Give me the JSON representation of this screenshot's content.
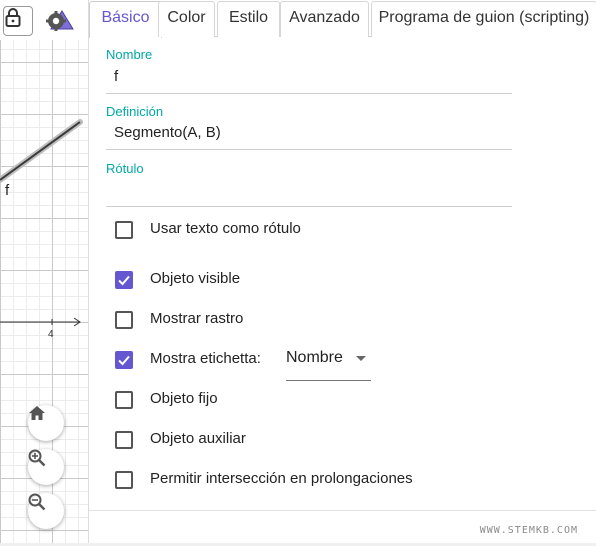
{
  "graphics": {
    "segment_label": "f",
    "x_tick_label": "4",
    "buttons": {
      "lock": "lock-icon",
      "style": "style-bar-icon",
      "home": "home-icon",
      "zoom_in": "zoom-in-icon",
      "zoom_out": "zoom-out-icon"
    }
  },
  "tabs": [
    {
      "label": "Básico",
      "active": true
    },
    {
      "label": "Color",
      "active": false
    },
    {
      "label": "Estilo",
      "active": false
    },
    {
      "label": "Avanzado",
      "active": false
    },
    {
      "label": "Programa de guion (scripting)",
      "active": false
    }
  ],
  "fields": {
    "name": {
      "label": "Nombre",
      "value": "f"
    },
    "definition": {
      "label": "Definición",
      "value": "Segmento(A, B)"
    },
    "caption": {
      "label": "Rótulo",
      "value": ""
    }
  },
  "checkboxes": [
    {
      "label": "Usar texto como rótulo",
      "checked": false
    },
    {
      "label": "Objeto visible",
      "checked": true
    },
    {
      "label": "Mostrar rastro",
      "checked": false
    },
    {
      "label": "Mostra etichetta:",
      "checked": true
    },
    {
      "label": "Objeto fijo",
      "checked": false
    },
    {
      "label": "Objeto auxiliar",
      "checked": false
    },
    {
      "label": "Permitir intersección en prolongaciones",
      "checked": false
    }
  ],
  "label_dropdown": {
    "selected": "Nombre"
  },
  "watermark": "WWW.STEMKB.COM",
  "colors": {
    "accent": "#6557d2",
    "field_label": "#00a8a8",
    "segment": "#444444"
  }
}
